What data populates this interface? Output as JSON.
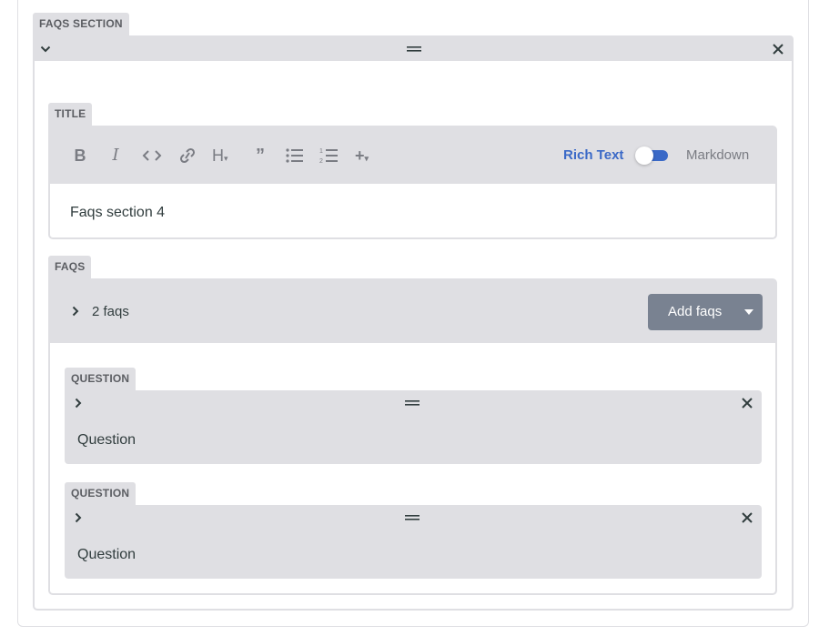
{
  "section": {
    "label": "FAQS SECTION",
    "icons": {
      "collapse": "chevron-down-icon",
      "drag": "drag-handle-icon",
      "remove": "close-icon"
    }
  },
  "title_field": {
    "label": "TITLE",
    "toolbar": {
      "buttons": [
        "bold-icon",
        "italic-icon",
        "code-icon",
        "link-icon",
        "heading-icon",
        "quote-icon",
        "bulleted-list-icon",
        "numbered-list-icon",
        "add-component-icon"
      ],
      "rich_text_label": "Rich Text",
      "markdown_label": "Markdown",
      "mode": "Rich Text"
    },
    "value": "Faqs section 4"
  },
  "faqs": {
    "label": "FAQS",
    "count_text": "2 faqs",
    "add_button": "Add faqs",
    "items": [
      {
        "label": "QUESTION",
        "summary": "Question"
      },
      {
        "label": "QUESTION",
        "summary": "Question"
      }
    ]
  },
  "colors": {
    "panel_bg": "#dfdfe3",
    "accent": "#3a69c7",
    "button_bg": "#798291",
    "text": "#313d3e"
  }
}
